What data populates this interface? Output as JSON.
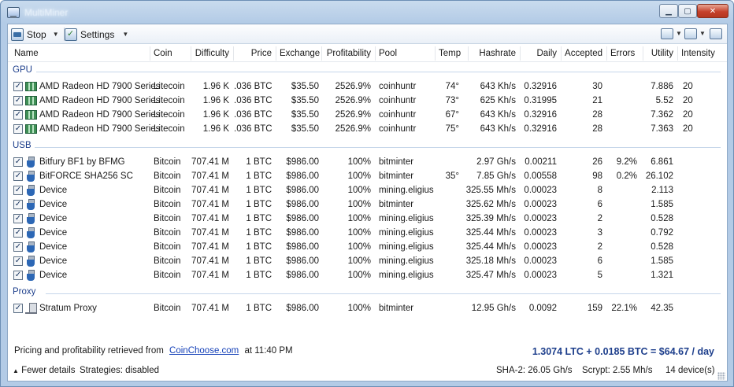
{
  "window": {
    "title": "MultiMiner"
  },
  "toolbar": {
    "stop_label": "Stop",
    "settings_label": "Settings"
  },
  "columns": [
    "Name",
    "Coin",
    "Difficulty",
    "Price",
    "Exchange",
    "Profitability",
    "Pool",
    "Temp",
    "Hashrate",
    "Daily",
    "Accepted",
    "Errors",
    "Utility",
    "Intensity"
  ],
  "groups": {
    "gpu": "GPU",
    "usb": "USB",
    "proxy": "Proxy"
  },
  "rows": {
    "gpu": [
      {
        "name": "AMD Radeon HD 7900 Series",
        "coin": "Litecoin",
        "difficulty": "1.96 K",
        "price": ".036 BTC",
        "exchange": "$35.50",
        "profitability": "2526.9%",
        "pool": "coinhuntr",
        "temp": "74°",
        "hashrate": "643 Kh/s",
        "daily": "0.32916",
        "accepted": "30",
        "errors": "",
        "utility": "7.886",
        "intensity": "20"
      },
      {
        "name": "AMD Radeon HD 7900 Series",
        "coin": "Litecoin",
        "difficulty": "1.96 K",
        "price": ".036 BTC",
        "exchange": "$35.50",
        "profitability": "2526.9%",
        "pool": "coinhuntr",
        "temp": "73°",
        "hashrate": "625 Kh/s",
        "daily": "0.31995",
        "accepted": "21",
        "errors": "",
        "utility": "5.52",
        "intensity": "20"
      },
      {
        "name": "AMD Radeon HD 7900 Series",
        "coin": "Litecoin",
        "difficulty": "1.96 K",
        "price": ".036 BTC",
        "exchange": "$35.50",
        "profitability": "2526.9%",
        "pool": "coinhuntr",
        "temp": "67°",
        "hashrate": "643 Kh/s",
        "daily": "0.32916",
        "accepted": "28",
        "errors": "",
        "utility": "7.362",
        "intensity": "20"
      },
      {
        "name": "AMD Radeon HD 7900 Series",
        "coin": "Litecoin",
        "difficulty": "1.96 K",
        "price": ".036 BTC",
        "exchange": "$35.50",
        "profitability": "2526.9%",
        "pool": "coinhuntr",
        "temp": "75°",
        "hashrate": "643 Kh/s",
        "daily": "0.32916",
        "accepted": "28",
        "errors": "",
        "utility": "7.363",
        "intensity": "20"
      }
    ],
    "usb": [
      {
        "name": "Bitfury BF1 by BFMG",
        "coin": "Bitcoin",
        "difficulty": "707.41 M",
        "price": "1 BTC",
        "exchange": "$986.00",
        "profitability": "100%",
        "pool": "bitminter",
        "temp": "",
        "hashrate": "2.97 Gh/s",
        "daily": "0.00211",
        "accepted": "26",
        "errors": "9.2%",
        "utility": "6.861",
        "intensity": ""
      },
      {
        "name": "BitFORCE SHA256 SC",
        "coin": "Bitcoin",
        "difficulty": "707.41 M",
        "price": "1 BTC",
        "exchange": "$986.00",
        "profitability": "100%",
        "pool": "bitminter",
        "temp": "35°",
        "hashrate": "7.85 Gh/s",
        "daily": "0.00558",
        "accepted": "98",
        "errors": "0.2%",
        "utility": "26.102",
        "intensity": ""
      },
      {
        "name": "Device",
        "coin": "Bitcoin",
        "difficulty": "707.41 M",
        "price": "1 BTC",
        "exchange": "$986.00",
        "profitability": "100%",
        "pool": "mining.eligius",
        "temp": "",
        "hashrate": "325.55 Mh/s",
        "daily": "0.00023",
        "accepted": "8",
        "errors": "",
        "utility": "2.113",
        "intensity": ""
      },
      {
        "name": "Device",
        "coin": "Bitcoin",
        "difficulty": "707.41 M",
        "price": "1 BTC",
        "exchange": "$986.00",
        "profitability": "100%",
        "pool": "bitminter",
        "temp": "",
        "hashrate": "325.62 Mh/s",
        "daily": "0.00023",
        "accepted": "6",
        "errors": "",
        "utility": "1.585",
        "intensity": ""
      },
      {
        "name": "Device",
        "coin": "Bitcoin",
        "difficulty": "707.41 M",
        "price": "1 BTC",
        "exchange": "$986.00",
        "profitability": "100%",
        "pool": "mining.eligius",
        "temp": "",
        "hashrate": "325.39 Mh/s",
        "daily": "0.00023",
        "accepted": "2",
        "errors": "",
        "utility": "0.528",
        "intensity": ""
      },
      {
        "name": "Device",
        "coin": "Bitcoin",
        "difficulty": "707.41 M",
        "price": "1 BTC",
        "exchange": "$986.00",
        "profitability": "100%",
        "pool": "mining.eligius",
        "temp": "",
        "hashrate": "325.44 Mh/s",
        "daily": "0.00023",
        "accepted": "3",
        "errors": "",
        "utility": "0.792",
        "intensity": ""
      },
      {
        "name": "Device",
        "coin": "Bitcoin",
        "difficulty": "707.41 M",
        "price": "1 BTC",
        "exchange": "$986.00",
        "profitability": "100%",
        "pool": "mining.eligius",
        "temp": "",
        "hashrate": "325.44 Mh/s",
        "daily": "0.00023",
        "accepted": "2",
        "errors": "",
        "utility": "0.528",
        "intensity": ""
      },
      {
        "name": "Device",
        "coin": "Bitcoin",
        "difficulty": "707.41 M",
        "price": "1 BTC",
        "exchange": "$986.00",
        "profitability": "100%",
        "pool": "mining.eligius",
        "temp": "",
        "hashrate": "325.18 Mh/s",
        "daily": "0.00023",
        "accepted": "6",
        "errors": "",
        "utility": "1.585",
        "intensity": ""
      },
      {
        "name": "Device",
        "coin": "Bitcoin",
        "difficulty": "707.41 M",
        "price": "1 BTC",
        "exchange": "$986.00",
        "profitability": "100%",
        "pool": "mining.eligius",
        "temp": "",
        "hashrate": "325.47 Mh/s",
        "daily": "0.00023",
        "accepted": "5",
        "errors": "",
        "utility": "1.321",
        "intensity": ""
      }
    ],
    "proxy": [
      {
        "name": "Stratum Proxy",
        "coin": "Bitcoin",
        "difficulty": "707.41 M",
        "price": "1 BTC",
        "exchange": "$986.00",
        "profitability": "100%",
        "pool": "bitminter",
        "temp": "",
        "hashrate": "12.95 Gh/s",
        "daily": "0.0092",
        "accepted": "159",
        "errors": "22.1%",
        "utility": "42.35",
        "intensity": ""
      }
    ]
  },
  "footer": {
    "pricing_prefix": "Pricing and profitability retrieved from",
    "pricing_link": "CoinChoose.com",
    "pricing_suffix": "at 11:40 PM",
    "total": "1.3074 LTC + 0.0185 BTC = $64.67 / day"
  },
  "status": {
    "fewer_details": "Fewer details",
    "strategies": "Strategies: disabled",
    "sha2": "SHA-2: 26.05 Gh/s",
    "scrypt": "Scrypt: 2.55 Mh/s",
    "devices": "14 device(s)"
  },
  "colors": {
    "group_label": "#1e3f8c",
    "link": "#1440b8",
    "total": "#1e3f8c"
  },
  "icons": {
    "gpu_row": "gpu-card-icon",
    "usb_row": "usb-device-icon",
    "proxy_row": "proxy-server-icon",
    "stop": "stop-icon",
    "settings": "settings-icon"
  }
}
